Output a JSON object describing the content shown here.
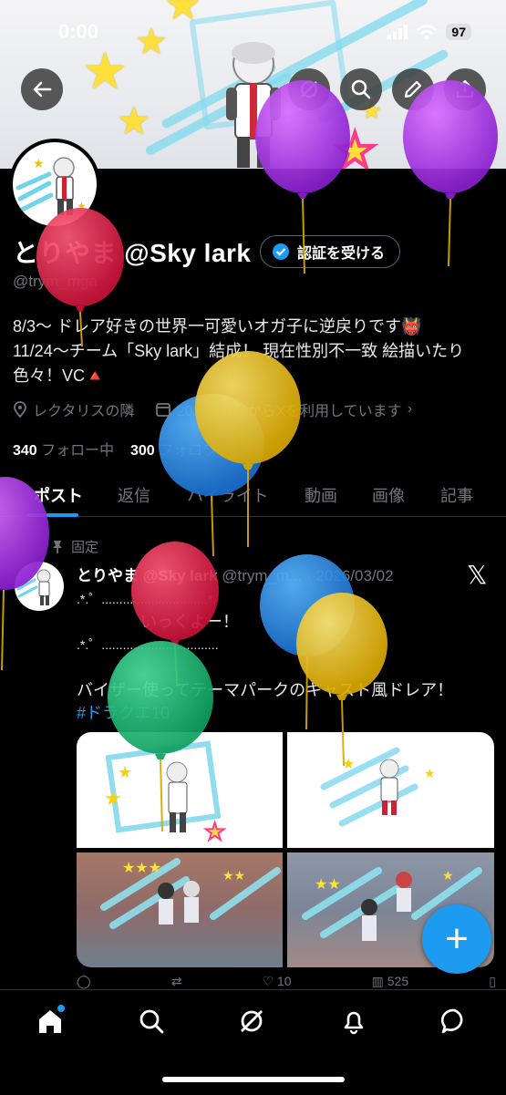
{
  "status_bar": {
    "time": "0:00",
    "battery": "97"
  },
  "profile": {
    "name": "とりやま @Sky lark",
    "verify_label": "認証を受ける",
    "handle": "@trym_mga",
    "bio_line1": "8/3～ ドレア好きの世界一可愛いオガ子に逆戻りです👹",
    "bio_line2": "11/24～チーム「Sky lark」結成！ 現在性別不一致 絵描いたり",
    "bio_line3": "色々！VC🔺",
    "location": "レクタリスの隣",
    "joined": "2020年3月からXを利用しています",
    "following_count": "340",
    "following_label": "フォロー中",
    "followers_count": "300",
    "followers_label": "フォロワー"
  },
  "tabs": [
    "ポスト",
    "返信",
    "ハイライト",
    "動画",
    "画像",
    "記事"
  ],
  "post": {
    "pinned_label": "固定",
    "author_name": "とりやま @Sky lark",
    "author_meta": "@trym_m... · 2026/03/02",
    "line1": ".*.゜..............................*.",
    "line2": "いっくよー！",
    "line3": ".*.゜.................................",
    "line4": "バイザー使ってテーマパークのキャスト風ドレア！",
    "hashtag": "#ドラクエ10",
    "actions": {
      "reply": "",
      "repost": "",
      "like": "10",
      "views": "525"
    }
  },
  "colors": {
    "accent": "#1d9bf0",
    "background": "#000000",
    "muted": "#71767b"
  },
  "icons": {
    "back": "arrow-left-icon",
    "grok": "grok-icon",
    "search": "search-icon",
    "edit": "pencil-icon",
    "share": "share-icon",
    "home": "home-icon",
    "explore": "search-icon",
    "grok_nav": "grok-icon",
    "notifications": "bell-icon",
    "messages": "message-icon"
  }
}
